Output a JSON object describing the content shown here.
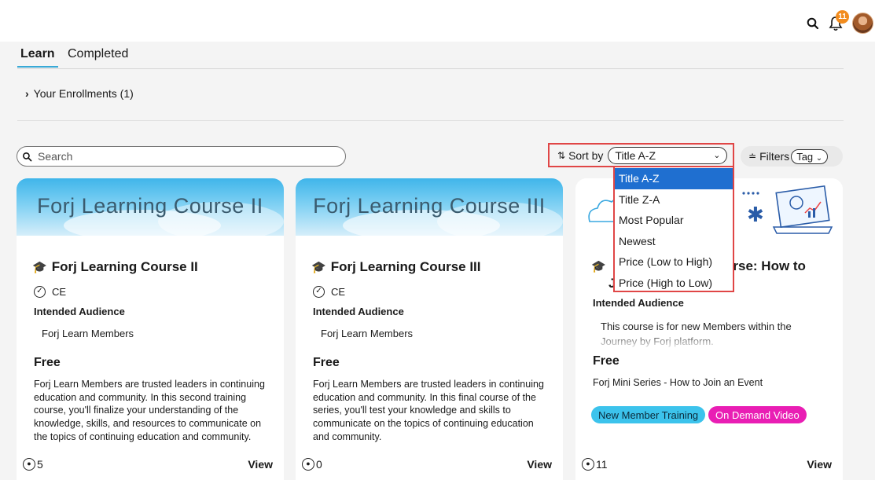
{
  "header": {
    "notification_count": "11"
  },
  "tabs": [
    {
      "label": "Learn",
      "active": true
    },
    {
      "label": "Completed",
      "active": false
    }
  ],
  "enrollments": {
    "label": "Your Enrollments (1)"
  },
  "search": {
    "placeholder": "Search",
    "value": ""
  },
  "sort": {
    "label": "Sort by",
    "selected": "Title A-Z",
    "options": [
      "Title A-Z",
      "Title Z-A",
      "Most Popular",
      "Newest",
      "Price (Low to High)",
      "Price (High to Low)"
    ]
  },
  "filters": {
    "label": "Filters",
    "tag_select": "Tag"
  },
  "cards": [
    {
      "banner_text": "Forj Learning Course II",
      "title": "Forj Learning Course II",
      "credential": "CE",
      "audience_heading": "Intended Audience",
      "audience": "Forj Learn Members",
      "price": "Free",
      "description": "Forj Learn Members are trusted leaders in continuing education and community. In this second training course, you'll finalize your understanding of the knowledge, skills, and resources to communicate on the topics of continuing education and community.",
      "members": "5",
      "view_label": "View"
    },
    {
      "banner_text": "Forj Learning Course III",
      "title": "Forj Learning Course III",
      "credential": "CE",
      "audience_heading": "Intended Audience",
      "audience": "Forj Learn Members",
      "price": "Free",
      "description": "Forj Learn Members are trusted leaders in continuing education and community. In this final course of the series, you'll test your knowledge and skills to communicate on the topics of continuing education and community.",
      "members": "0",
      "view_label": "View"
    },
    {
      "title_tail": "urse: How to",
      "title_line2": "J",
      "audience_heading": "Intended Audience",
      "audience": "This course is for new Members within the Journey by Forj platform.",
      "price": "Free",
      "description": "Forj Mini Series - How to Join an Event",
      "tags": [
        {
          "label": "New Member Training",
          "color": "#3cc3ec"
        },
        {
          "label": "On Demand Video",
          "color": "#e91eb4"
        }
      ],
      "members": "11",
      "view_label": "View"
    }
  ],
  "colors": {
    "accent": "#39a9d6",
    "highlight_border": "#e04646",
    "selected_option": "#1f6fd0",
    "badge": "#f28c1e"
  }
}
